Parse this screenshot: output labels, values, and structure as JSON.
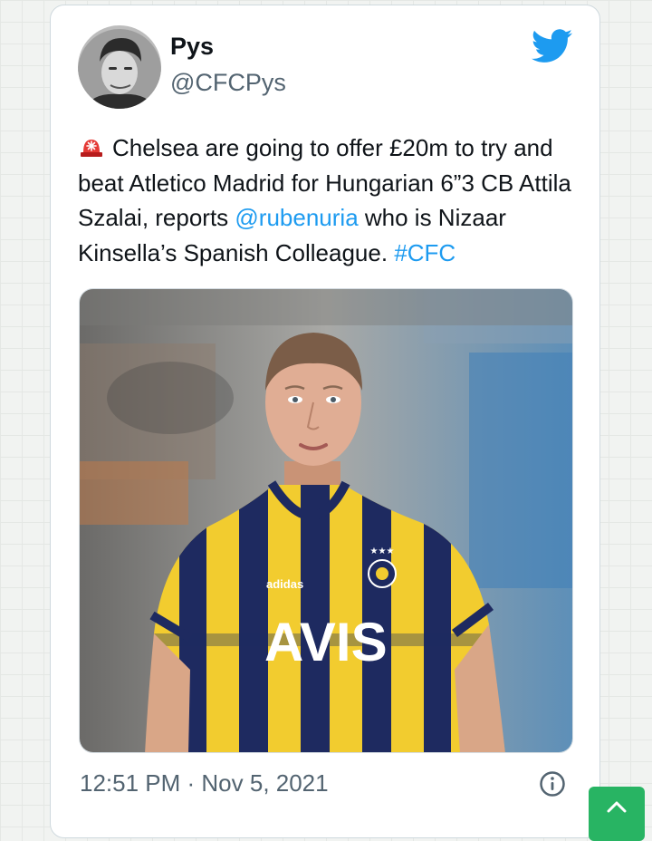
{
  "tweet": {
    "display_name": "Pys",
    "handle": "@CFCPys",
    "text": {
      "emoji_icon": "police-light-siren-icon",
      "part1": "Chelsea are going to offer £20m to try and beat Atletico Madrid for Hungarian 6”3 CB Attila Szalai, reports ",
      "mention": "@rubenuria",
      "part2": " who is Nizaar Kinsella’s Spanish Colleague. ",
      "hashtag": "#CFC"
    },
    "timestamp": "12:51 PM · Nov 5, 2021",
    "media": {
      "jersey_sponsor": "AVIS",
      "jersey_brand": "adidas"
    }
  },
  "icons": {
    "brand": "twitter-bird-icon",
    "info": "info-icon",
    "scroll_top": "chevron-up-icon"
  },
  "colors": {
    "link": "#1d9bf0",
    "twitter_blue": "#1d9bf0",
    "text_primary": "#0f1419",
    "text_secondary": "#536471",
    "scroll_button": "#28b463"
  }
}
